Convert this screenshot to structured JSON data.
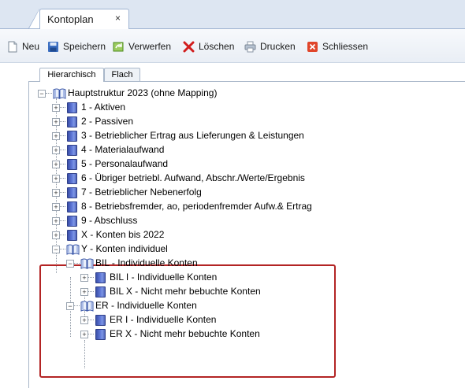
{
  "doc_tab": {
    "label": "Kontoplan",
    "close": "×"
  },
  "toolbar": {
    "new": "Neu",
    "save": "Speichern",
    "discard": "Verwerfen",
    "delete": "Löschen",
    "print": "Drucken",
    "close": "Schliessen"
  },
  "view_tabs": [
    "Hierarchisch",
    "Flach"
  ],
  "tree": {
    "root": "Hauptstruktur 2023 (ohne Mapping)",
    "items": [
      "1 - Aktiven",
      "2 - Passiven",
      "3 - Betrieblicher Ertrag aus Lieferungen & Leistungen",
      "4 - Materialaufwand",
      "5 - Personalaufwand",
      "6 - Übriger betriebl. Aufwand, Abschr./Werte/Ergebnis",
      "7 - Betrieblicher Nebenerfolg",
      "8 - Betriebsfremder, ao, periodenfremder Aufw.& Ertrag",
      "9 - Abschluss",
      "X - Konten bis 2022",
      "Y - Konten individuel"
    ],
    "y_children": [
      {
        "label": "BIL - Individuelle Konten",
        "children": [
          "BIL I - Individuelle Konten",
          "BIL X - Nicht mehr bebuchte Konten"
        ]
      },
      {
        "label": "ER - Individuelle Konten",
        "children": [
          "ER I - Individuelle Konten",
          "ER X - Nicht mehr bebuchte Konten"
        ]
      }
    ]
  },
  "colors": {
    "highlight": "#b32424",
    "tab_strip": "#dde6f2",
    "book": "#4f63b9"
  }
}
